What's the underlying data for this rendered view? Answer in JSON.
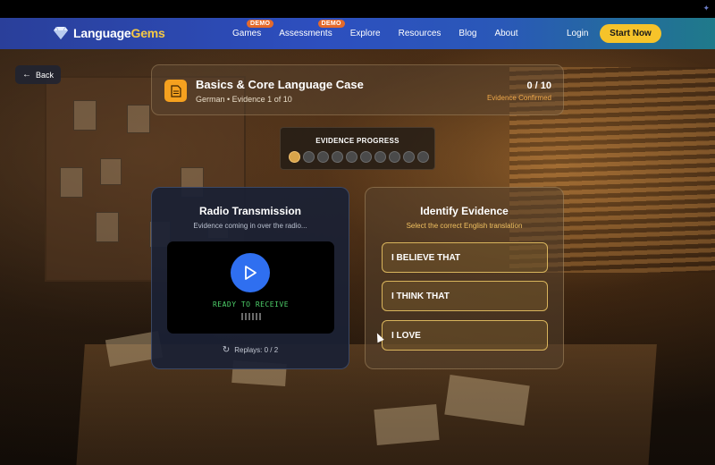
{
  "nav": {
    "logo_part1": "Language",
    "logo_part2": "Gems",
    "items": [
      {
        "label": "Games",
        "badge": "DEMO"
      },
      {
        "label": "Assessments",
        "badge": "DEMO"
      },
      {
        "label": "Explore"
      },
      {
        "label": "Resources"
      },
      {
        "label": "Blog"
      },
      {
        "label": "About"
      }
    ],
    "login": "Login",
    "cta": "Start Now"
  },
  "back": {
    "label": "Back"
  },
  "case": {
    "title": "Basics & Core Language Case",
    "subtitle": "German • Evidence 1 of 10",
    "count": "0 / 10",
    "count_label": "Evidence Confirmed"
  },
  "progress": {
    "label": "EVIDENCE PROGRESS",
    "total": 10,
    "current": 1
  },
  "radio": {
    "title": "Radio Transmission",
    "subtitle": "Evidence coming in over the radio...",
    "status": "READY TO RECEIVE",
    "replays": "Replays: 0 / 2"
  },
  "evidence": {
    "title": "Identify Evidence",
    "subtitle": "Select the correct English translation",
    "options": [
      "I BELIEVE THAT",
      "I THINK THAT",
      "I LOVE"
    ]
  },
  "colors": {
    "accent": "#f6c32a",
    "play_button": "#2f6ff0",
    "ready_text": "#4ed06a",
    "option_border": "#d8b45c"
  }
}
